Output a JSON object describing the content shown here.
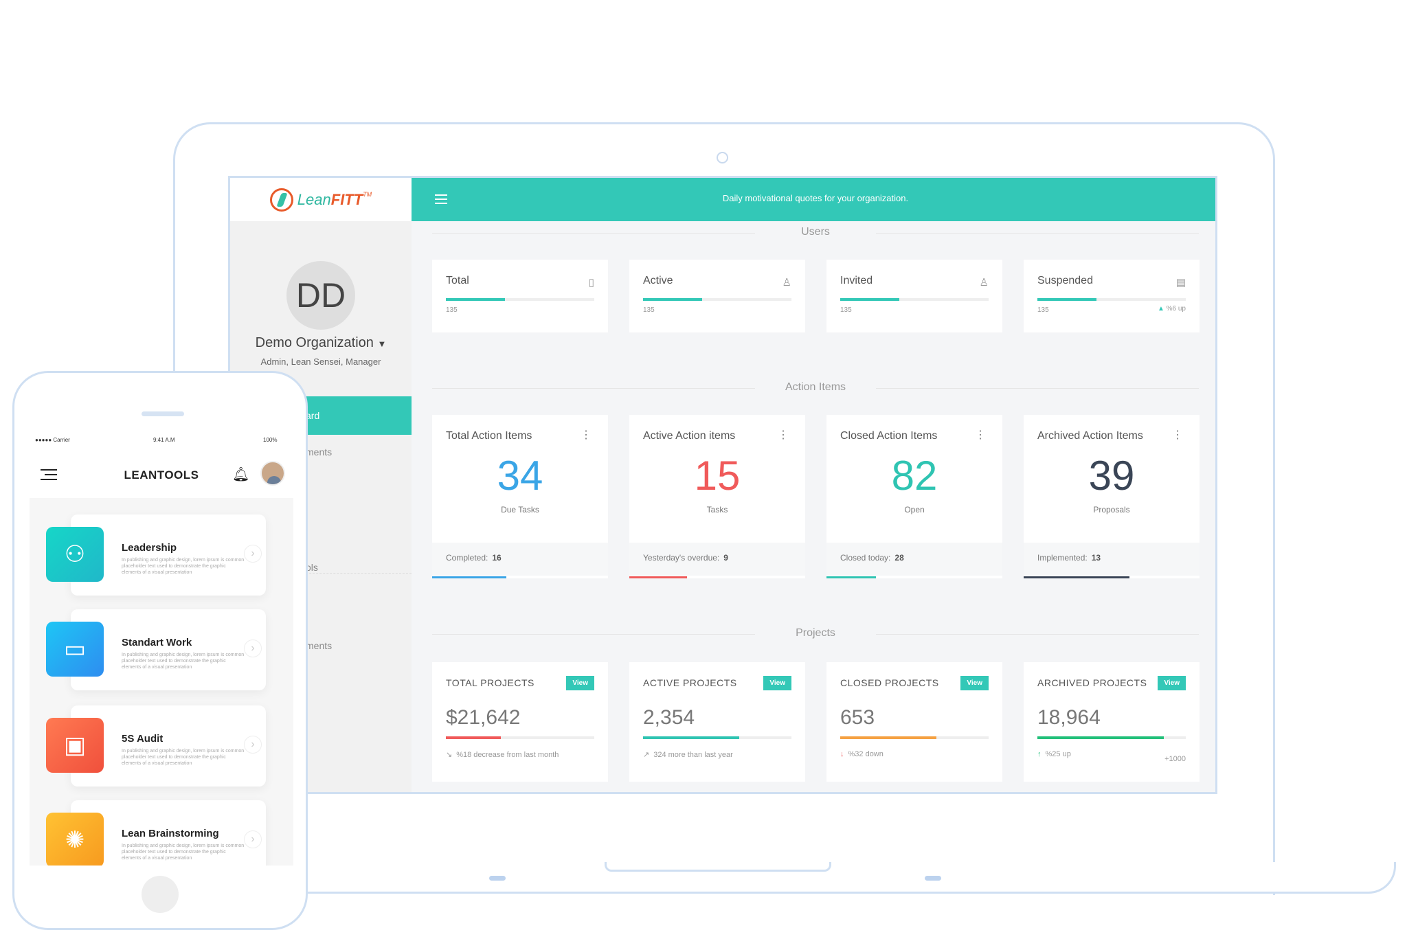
{
  "app": {
    "logo_text": "Lean",
    "logo_bold": "FITT",
    "logo_tm": "TM",
    "quote": "Daily motivational quotes for your organization."
  },
  "sidebar": {
    "initials": "DD",
    "org_name": "Demo Organization",
    "roles": "Admin, Lean Sensei, Manager",
    "active_item": "ard",
    "items": [
      "ments",
      "ols",
      "ments"
    ]
  },
  "users": {
    "section_title": "Users",
    "cards": [
      {
        "label": "Total",
        "icon": "tablet-icon",
        "count": "135",
        "progress": 0.4
      },
      {
        "label": "Active",
        "icon": "user-icon",
        "count": "135",
        "progress": 0.4
      },
      {
        "label": "Invited",
        "icon": "user-icon",
        "count": "135",
        "progress": 0.4
      },
      {
        "label": "Suspended",
        "icon": "id-card-icon",
        "count": "135",
        "progress": 0.4,
        "trend": "%6 up"
      }
    ]
  },
  "action_items": {
    "section_title": "Action Items",
    "cards": [
      {
        "label": "Total Action Items",
        "value": "34",
        "sub": "Due Tasks",
        "foot_label": "Completed:",
        "foot_value": "16",
        "color": "#3aa5e6",
        "underline": 0.42
      },
      {
        "label": "Active Action items",
        "value": "15",
        "sub": "Tasks",
        "foot_label": "Yesterday's overdue:",
        "foot_value": "9",
        "color": "#f05a5a",
        "underline": 0.33
      },
      {
        "label": "Closed Action Items",
        "value": "82",
        "sub": "Open",
        "foot_label": "Closed today:",
        "foot_value": "28",
        "color": "#2fc4b2",
        "underline": 0.28
      },
      {
        "label": "Archived Action Items",
        "value": "39",
        "sub": "Proposals",
        "foot_label": "Implemented:",
        "foot_value": "13",
        "color": "#3a4556",
        "underline": 0.6
      }
    ]
  },
  "projects": {
    "section_title": "Projects",
    "view_label": "View",
    "cards": [
      {
        "label": "TOTAL PROJECTS",
        "value": "$21,642",
        "progress": 0.37,
        "color": "#f05a5a",
        "note_icon": "trend-down-icon",
        "note": "%18 decrease from last month"
      },
      {
        "label": "ACTIVE PROJECTS",
        "value": "2,354",
        "progress": 0.65,
        "color": "#2fc4b2",
        "note_icon": "trend-up-icon",
        "note": "324 more than last year"
      },
      {
        "label": "CLOSED PROJECTS",
        "value": "653",
        "progress": 0.65,
        "color": "#f5a142",
        "note_icon": "arrow-down-icon",
        "note": "%32 down"
      },
      {
        "label": "ARCHIVED PROJECTS",
        "value": "18,964",
        "progress": 0.85,
        "color": "#22c07a",
        "note_icon": "arrow-up-icon",
        "note": "%25 up",
        "extra": "+1000"
      }
    ]
  },
  "phone": {
    "carrier": "●●●●● Carrier",
    "time": "9:41 A.M",
    "battery": "100%",
    "title": "LEANTOOLS",
    "tools": [
      {
        "name": "Leadership",
        "desc": "In publishing and graphic design, lorem ipsum is common placeholder text used to demonstrate the graphic elements of a visual presentation",
        "icon": "people-icon",
        "color1": "#16d6c8",
        "color2": "#20b8c9"
      },
      {
        "name": "Standart Work",
        "desc": "In publishing and graphic design, lorem ipsum is common placeholder text used to demonstrate the graphic elements of a visual presentation",
        "icon": "briefcase-icon",
        "color1": "#1ec6f5",
        "color2": "#2e8df0"
      },
      {
        "name": "5S Audit",
        "desc": "In publishing and graphic design, lorem ipsum is common placeholder text used to demonstrate the graphic elements of a visual presentation",
        "icon": "presentation-icon",
        "color1": "#ff7a52",
        "color2": "#f0503c"
      },
      {
        "name": "Lean Brainstorming",
        "desc": "In publishing and graphic design, lorem ipsum is common placeholder text used to demonstrate the graphic elements of a visual presentation",
        "icon": "brain-icon",
        "color1": "#ffc233",
        "color2": "#f79a1f"
      }
    ]
  }
}
